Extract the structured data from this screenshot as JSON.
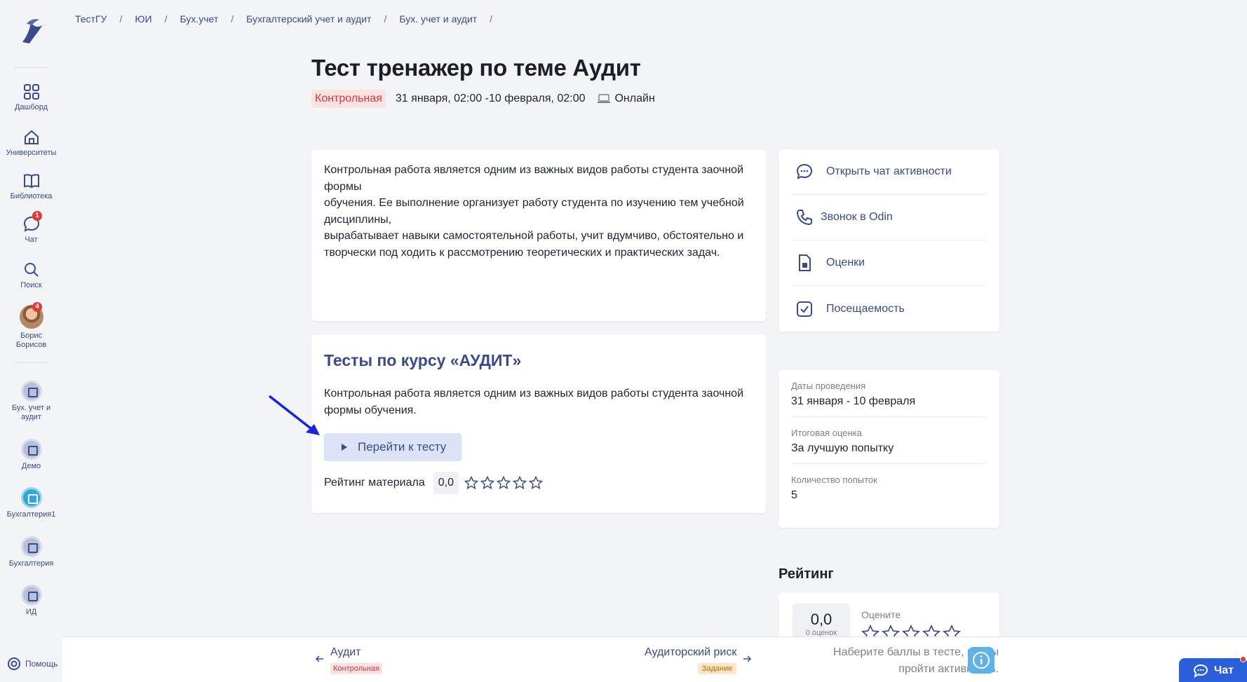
{
  "breadcrumbs": [
    "ТестГУ",
    "ЮИ",
    "Бух.учет",
    "Бухгалтерский учет и аудит",
    "Бух. учет и аудит"
  ],
  "sidebar": {
    "nav": [
      {
        "label": "Дашборд"
      },
      {
        "label": "Университеты"
      },
      {
        "label": "Библиотека"
      },
      {
        "label": "Чат",
        "badge": "1"
      },
      {
        "label": "Поиск"
      }
    ],
    "user": {
      "name": "Борис Борисов",
      "badge": "4"
    },
    "courses": [
      "Бух. учет и аудит",
      "Демо",
      "Бухгалтерия1",
      "Бухгалтерия",
      "ИД"
    ],
    "help": "Помощь"
  },
  "activity": {
    "title": "Тест тренажер по теме Аудит",
    "type": "Контрольная",
    "dates": "31 января, 02:00 -10 февраля, 02:00",
    "format": "Онлайн",
    "description": "Контрольная работа является одним из важных видов работы студента заочной формы\nобучения. Ее выполнение организует работу студента по изучению тем учебной дисциплины,\nвырабатывает навыки самостоятельной работы, учит вдумчиво, обстоятельно и творчески под    ходить к рассмотрению теоретических и практических задач."
  },
  "tests": {
    "title": "Тесты по курсу «АУДИТ»",
    "description": "Контрольная работа является одним из важных видов работы студента заочной формы обучения.",
    "button": "Перейти к тесту",
    "rating_label": "Рейтинг материала",
    "rating_value": "0,0",
    "stars": 0
  },
  "actions": [
    {
      "label": "Открыть чат активности",
      "icon": "chat-icon"
    },
    {
      "label": "Звонок в Odin",
      "icon": "phone-icon"
    },
    {
      "label": "Оценки",
      "icon": "grades-icon"
    },
    {
      "label": "Посещаемость",
      "icon": "attendance-icon"
    }
  ],
  "info": [
    {
      "label": "Даты проведения",
      "value": "31 января - 10 февраля"
    },
    {
      "label": "Итоговая оценка",
      "value": "За лучшую попытку"
    },
    {
      "label": "Количество попыток",
      "value": "5"
    }
  ],
  "rating": {
    "heading": "Рейтинг",
    "value": "0,0",
    "count": "0 оценок",
    "rate_label": "Оцените"
  },
  "bottom": {
    "prev_title": "Аудит",
    "prev_tag": "Контрольная",
    "next_title": "Аудиторский риск",
    "next_tag": "Задание",
    "hint": "Наберите баллы в тесте, чтобы пройти активность.",
    "chat": "Чат"
  },
  "colors": {
    "accent": "#3a4a8c",
    "tag_red": "#d9363e",
    "button_bg": "#dde3f6",
    "chat_blue": "#2b5fd9"
  }
}
